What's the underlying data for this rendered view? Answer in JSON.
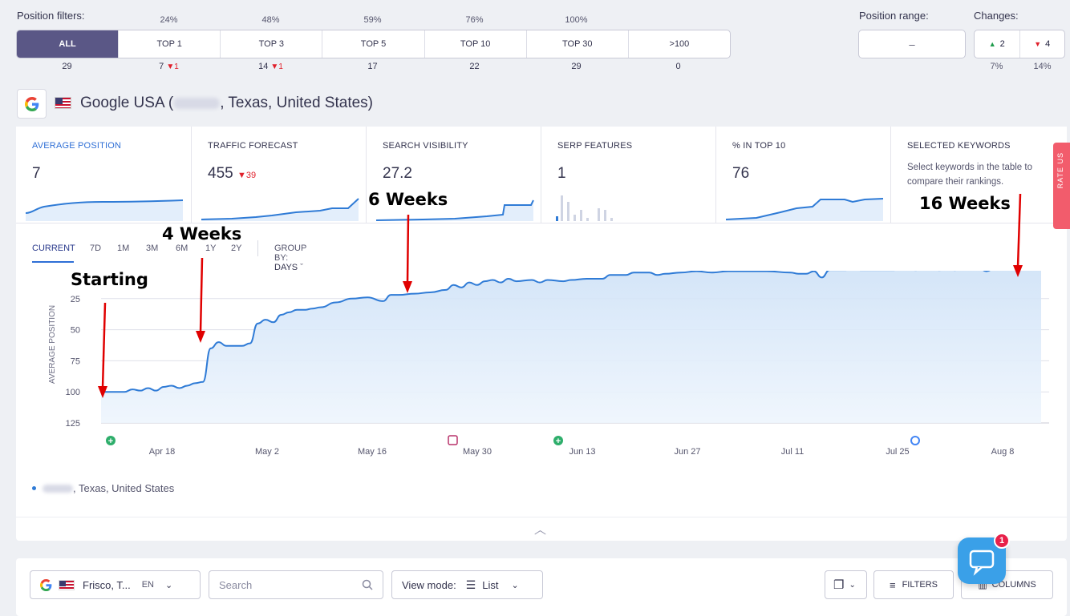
{
  "filters": {
    "label": "Position filters:",
    "percentages": [
      "24%",
      "48%",
      "59%",
      "76%",
      "100%"
    ],
    "buttons": [
      "ALL",
      "TOP 1",
      "TOP 3",
      "TOP 5",
      "TOP 10",
      "TOP 30",
      ">100"
    ],
    "counts": [
      "29",
      "7",
      "14",
      "17",
      "22",
      "29",
      "0"
    ],
    "count_changes": [
      "",
      "1",
      "1",
      "",
      "",
      "",
      ""
    ]
  },
  "position_range": {
    "label": "Position range:",
    "value": "–"
  },
  "changes": {
    "label": "Changes:",
    "up": "2",
    "down": "4",
    "up_pct": "7%",
    "down_pct": "14%"
  },
  "engine": {
    "title": "Google USA",
    "location": ", Texas, United States)",
    "open_paren": "("
  },
  "metrics": [
    {
      "title": "AVERAGE POSITION",
      "value": "7",
      "delta": ""
    },
    {
      "title": "TRAFFIC FORECAST",
      "value": "455",
      "delta": "39"
    },
    {
      "title": "SEARCH VISIBILITY",
      "value": "27.2",
      "delta": ""
    },
    {
      "title": "SERP FEATURES",
      "value": "1",
      "delta": ""
    },
    {
      "title": "% IN TOP 10",
      "value": "76",
      "delta": ""
    },
    {
      "title": "SELECTED KEYWORDS",
      "value": "Select keywords in the table to compare their rankings.",
      "delta": ""
    }
  ],
  "rate_us": "RATE US",
  "tabs": [
    "CURRENT",
    "7D",
    "1M",
    "3M",
    "6M",
    "1Y",
    "2Y"
  ],
  "group_by": {
    "label": "GROUP BY:",
    "value": "DAYS"
  },
  "annotations": [
    "Starting",
    "4 Weeks",
    "6 Weeks",
    "16 Weeks"
  ],
  "legend": ", Texas, United States",
  "chart_data": {
    "type": "area",
    "ylabel": "AVERAGE POSITION",
    "yticks": [
      25,
      50,
      75,
      100,
      125
    ],
    "ylim": [
      125,
      0
    ],
    "inverted_y": true,
    "xticks": [
      "Apr 18",
      "May 2",
      "May 16",
      "May 30",
      "Jun 13",
      "Jun 27",
      "Jul 11",
      "Jul 25",
      "Aug 8"
    ],
    "series": [
      {
        "values": [
          [
            0,
            100
          ],
          [
            3,
            100
          ],
          [
            4,
            98
          ],
          [
            5,
            99
          ],
          [
            6,
            97
          ],
          [
            7,
            99
          ],
          [
            8,
            96
          ],
          [
            9,
            95
          ],
          [
            10,
            97
          ],
          [
            11,
            95
          ],
          [
            12,
            93
          ],
          [
            13,
            92
          ],
          [
            14,
            65
          ],
          [
            15,
            60
          ],
          [
            16,
            63
          ],
          [
            17,
            63
          ],
          [
            18,
            63
          ],
          [
            19,
            61
          ],
          [
            20,
            45
          ],
          [
            21,
            42
          ],
          [
            22,
            44
          ],
          [
            23,
            38
          ],
          [
            24,
            36
          ],
          [
            25,
            34
          ],
          [
            26,
            34
          ],
          [
            27,
            33
          ],
          [
            28,
            32
          ],
          [
            30,
            28
          ],
          [
            32,
            25
          ],
          [
            34,
            24
          ],
          [
            36,
            27
          ],
          [
            37,
            22
          ],
          [
            38,
            22
          ],
          [
            40,
            21
          ],
          [
            42,
            20
          ],
          [
            44,
            18
          ],
          [
            45,
            14
          ],
          [
            46,
            16
          ],
          [
            47,
            12
          ],
          [
            48,
            14
          ],
          [
            49,
            11
          ],
          [
            50,
            10
          ],
          [
            51,
            12
          ],
          [
            52,
            9
          ],
          [
            53,
            11
          ],
          [
            55,
            10
          ],
          [
            56,
            12
          ],
          [
            57,
            10
          ],
          [
            59,
            11
          ],
          [
            60,
            10
          ],
          [
            62,
            9
          ],
          [
            64,
            9
          ],
          [
            65,
            6
          ],
          [
            67,
            6
          ],
          [
            68,
            4
          ],
          [
            70,
            4
          ],
          [
            71,
            6
          ],
          [
            72,
            5
          ],
          [
            74,
            4
          ],
          [
            76,
            3
          ],
          [
            78,
            4
          ],
          [
            80,
            3
          ],
          [
            82,
            3
          ],
          [
            85,
            3
          ],
          [
            88,
            4
          ],
          [
            89,
            5
          ],
          [
            90,
            5
          ],
          [
            91,
            3
          ],
          [
            92,
            8
          ],
          [
            93,
            2
          ],
          [
            95,
            2
          ],
          [
            96,
            1
          ],
          [
            97,
            2
          ],
          [
            99,
            2
          ],
          [
            101,
            2
          ],
          [
            103,
            1
          ],
          [
            104,
            2
          ],
          [
            105,
            0
          ],
          [
            106,
            1
          ],
          [
            107,
            2
          ],
          [
            108,
            1
          ],
          [
            109,
            2
          ],
          [
            110,
            0
          ],
          [
            111,
            1
          ],
          [
            112,
            0
          ],
          [
            113,
            3
          ],
          [
            114,
            1
          ],
          [
            115,
            0
          ],
          [
            116,
            1
          ],
          [
            118,
            0
          ],
          [
            120,
            0
          ]
        ]
      }
    ]
  },
  "toolbar": {
    "location": "Frisco, T...",
    "lang": "EN",
    "search_placeholder": "Search",
    "view_mode_label": "View mode:",
    "view_mode_value": "List",
    "filters_label": "FILTERS",
    "columns_label": "COLUMNS"
  },
  "chat_badge": "1"
}
